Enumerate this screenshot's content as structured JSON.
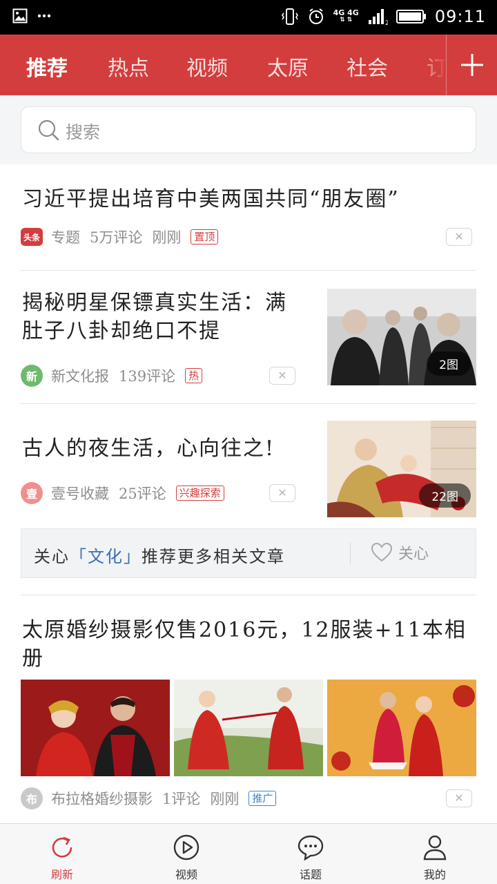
{
  "status_bar": {
    "network": "4G 4G",
    "time": "09:11"
  },
  "channels": {
    "tabs": [
      "推荐",
      "热点",
      "视频",
      "太原",
      "社会",
      "订阅"
    ],
    "active_index": 0
  },
  "search": {
    "placeholder": "搜索"
  },
  "feed": {
    "article1": {
      "title": "习近平提出培育中美两国共同“朋友圈”",
      "source_badge": "头条",
      "source": "专题",
      "comments": "5万评论",
      "time": "刚刚",
      "tag": "置顶",
      "dismiss_icon": "close-icon"
    },
    "article2": {
      "title": "揭秘明星保镖真实生活：满肚子八卦却绝口不提",
      "source_badge": "新",
      "source": "新文化报",
      "comments": "139评论",
      "tag": "热",
      "image_count": "2图"
    },
    "article3": {
      "title": "古人的夜生活，心向往之!",
      "source_badge": "壹",
      "source": "壹号收藏",
      "comments": "25评论",
      "tag": "兴趣探索",
      "image_count": "22图"
    },
    "follow": {
      "prefix": "关心",
      "topic": "「文化」",
      "suffix": "推荐更多相关文章",
      "button": "关心"
    },
    "article4": {
      "title": "太原婚纱摄影仅售2016元，12服装+11本相册",
      "source_badge": "布",
      "source": "布拉格婚纱摄影",
      "comments": "1评论",
      "time": "刚刚",
      "tag": "推广"
    }
  },
  "bottom_nav": {
    "items": [
      {
        "label": "刷新",
        "icon": "refresh-icon"
      },
      {
        "label": "视频",
        "icon": "play-icon"
      },
      {
        "label": "话题",
        "icon": "chat-icon"
      },
      {
        "label": "我的",
        "icon": "user-icon"
      }
    ],
    "active_index": 0
  },
  "colors": {
    "brand_red": "#d43d3d",
    "tag_blue": "#3a86c8",
    "source_green": "#6fb96f",
    "source_pink": "#f18e8e",
    "source_gray": "#c9c9c9"
  }
}
